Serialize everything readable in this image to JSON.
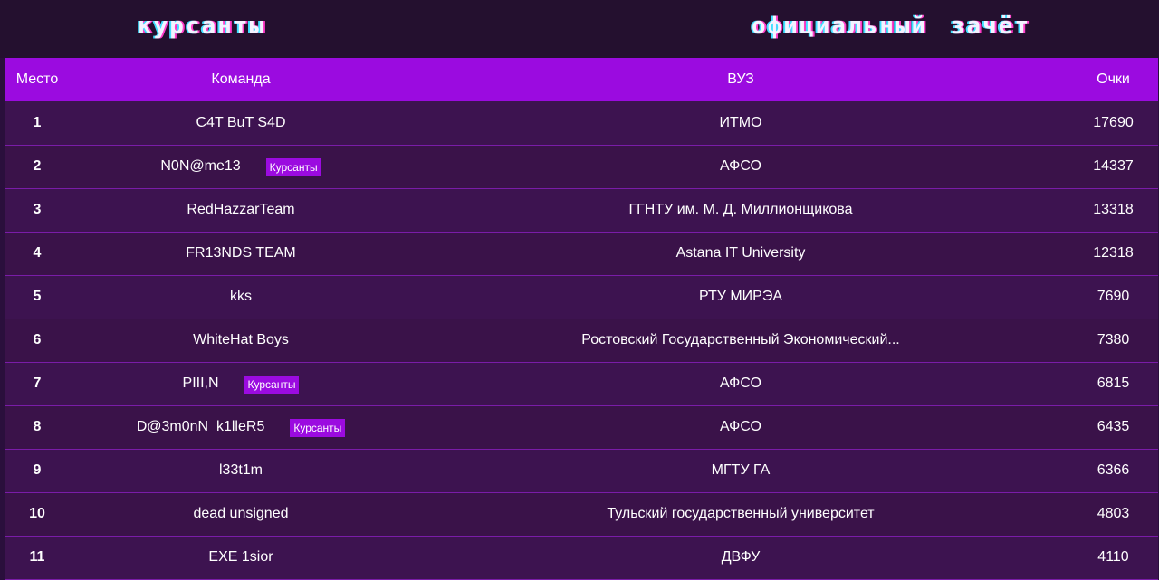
{
  "header": {
    "left_title": "курсанты",
    "right_title": "официальный зачёт"
  },
  "table": {
    "columns": [
      "Место",
      "Команда",
      "ВУЗ",
      "Очки"
    ],
    "rows": [
      {
        "place": "1",
        "team": "C4T BuT S4D",
        "badge": "",
        "university": "ИТМО",
        "score": "17690"
      },
      {
        "place": "2",
        "team": "N0N@me13",
        "badge": "Курсанты",
        "university": "АФСО",
        "score": "14337"
      },
      {
        "place": "3",
        "team": "RedHazzarTeam",
        "badge": "",
        "university": "ГГНТУ им. М. Д. Миллионщикова",
        "score": "13318"
      },
      {
        "place": "4",
        "team": "FR13NDS TEAM",
        "badge": "",
        "university": "Astana IT University",
        "score": "12318"
      },
      {
        "place": "5",
        "team": "kks",
        "badge": "",
        "university": "РТУ МИРЭА",
        "score": "7690"
      },
      {
        "place": "6",
        "team": "WhiteHat Boys",
        "badge": "",
        "university": "Ростовский Государственный Экономический...",
        "score": "7380"
      },
      {
        "place": "7",
        "team": "PIII,N",
        "badge": "Курсанты",
        "university": "АФСО",
        "score": "6815"
      },
      {
        "place": "8",
        "team": "D@3m0nN_k1lleR5",
        "badge": "Курсанты",
        "university": "АФСО",
        "score": "6435"
      },
      {
        "place": "9",
        "team": "l33t1m",
        "badge": "",
        "university": "МГТУ ГА",
        "score": "6366"
      },
      {
        "place": "10",
        "team": "dead unsigned",
        "badge": "",
        "university": "Тульский государственный университет",
        "score": "4803"
      },
      {
        "place": "11",
        "team": "EXE 1sior",
        "badge": "",
        "university": "ДВФУ",
        "score": "4110"
      }
    ]
  },
  "colors": {
    "header_bg": "#9b0be0",
    "row_bg": "#3d1350",
    "badge_bg": "#9b0be0",
    "page_bg": "#24102f"
  }
}
